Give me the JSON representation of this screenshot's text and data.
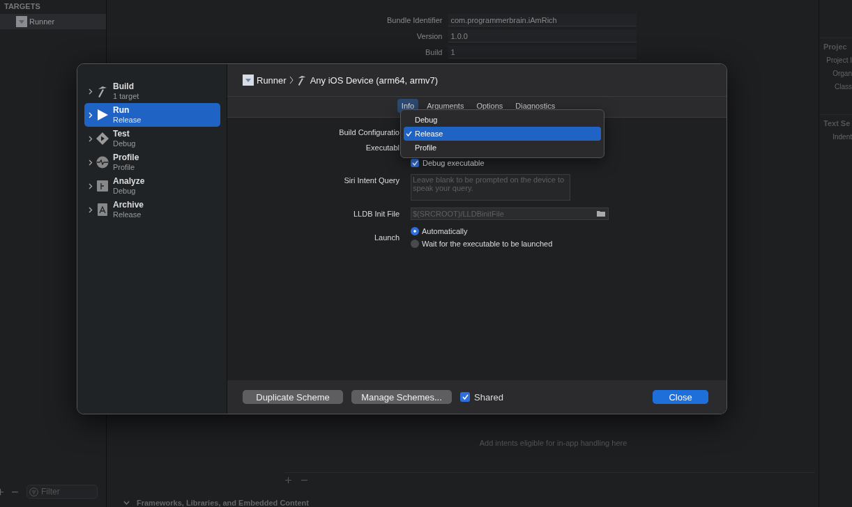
{
  "sidebar": {
    "section": "TARGETS",
    "items": [
      {
        "label": "Runner",
        "selected": true
      }
    ],
    "filter": {
      "placeholder": "Filter"
    }
  },
  "general": {
    "fields": [
      {
        "label": "Bundle Identifier",
        "value": "com.programmerbrain.iAmRich"
      },
      {
        "label": "Version",
        "value": "1.0.0"
      },
      {
        "label": "Build",
        "value": "1"
      }
    ]
  },
  "intents": {
    "empty_text": "Add intents eligible for in-app handling here"
  },
  "frameworks_section": {
    "title": "Frameworks, Libraries, and Embedded Content",
    "expanded": true
  },
  "inspector": {
    "sections": [
      {
        "title": "Projec",
        "labels": [
          "Project I",
          "Organ",
          "Class"
        ]
      },
      {
        "title": "Text Se",
        "labels": [
          "Indent"
        ]
      }
    ]
  },
  "dialog": {
    "schemes": [
      {
        "kind": "build",
        "name": "Build",
        "detail": "1 target",
        "selected": false
      },
      {
        "kind": "run",
        "name": "Run",
        "detail": "Release",
        "selected": true
      },
      {
        "kind": "test",
        "name": "Test",
        "detail": "Debug",
        "selected": false
      },
      {
        "kind": "profile",
        "name": "Profile",
        "detail": "Profile",
        "selected": false
      },
      {
        "kind": "analyze",
        "name": "Analyze",
        "detail": "Debug",
        "selected": false
      },
      {
        "kind": "archive",
        "name": "Archive",
        "detail": "Release",
        "selected": false
      }
    ],
    "breadcrumb": {
      "project": "Runner",
      "destination": "Any iOS Device (arm64, armv7)"
    },
    "tabs": [
      {
        "label": "Info",
        "selected": true
      },
      {
        "label": "Arguments",
        "selected": false
      },
      {
        "label": "Options",
        "selected": false
      },
      {
        "label": "Diagnostics",
        "selected": false
      }
    ],
    "form": {
      "build_configuration_label": "Build Configuratio",
      "executable_label": "Executabl",
      "debug_executable": {
        "label": "Debug executable",
        "checked": true
      },
      "siri_intent": {
        "label": "Siri Intent Query",
        "placeholder": "Leave blank to be prompted on the device to speak your query."
      },
      "lldb_init": {
        "label": "LLDB Init File",
        "placeholder": "$(SRCROOT)/LLDBinitFile"
      },
      "launch": {
        "label": "Launch",
        "options": [
          {
            "label": "Automatically",
            "selected": true
          },
          {
            "label": "Wait for the executable to be launched",
            "selected": false
          }
        ]
      }
    },
    "menu": {
      "items": [
        {
          "label": "Debug",
          "selected": false
        },
        {
          "label": "Release",
          "selected": true
        },
        {
          "label": "Profile",
          "selected": false
        }
      ]
    },
    "buttons": [
      "Duplicate Scheme",
      "Manage Schemes..."
    ],
    "shared": {
      "label": "Shared",
      "checked": true
    },
    "close": "Close"
  }
}
